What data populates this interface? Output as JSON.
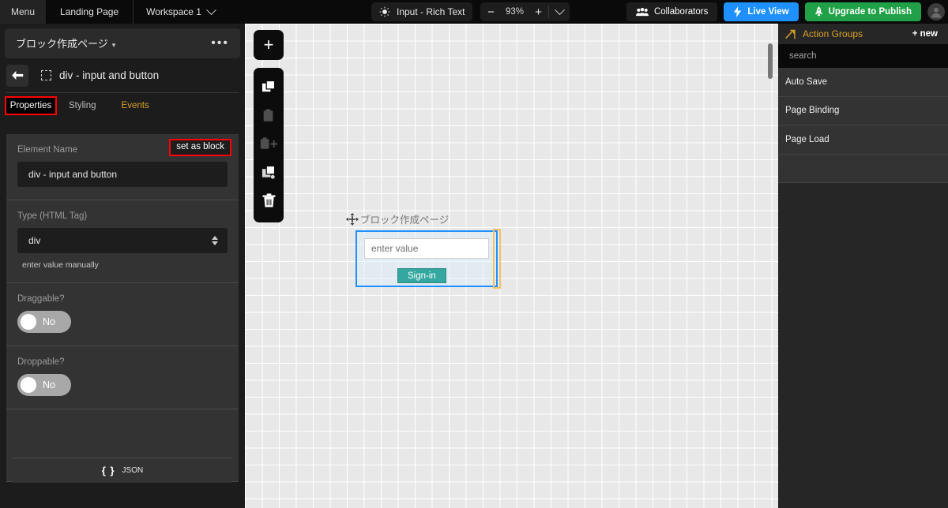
{
  "topbar": {
    "menu": "Menu",
    "page": "Landing Page",
    "workspace": "Workspace 1",
    "mode_pill": "Input - Rich Text",
    "zoom_minus": "−",
    "zoom_value": "93%",
    "zoom_plus": "+",
    "collaborators": "Collaborators",
    "live_view": "Live View",
    "upgrade": "Upgrade to Publish",
    "accent_blue": "#1e90ff",
    "accent_green": "#21a147"
  },
  "left_panel": {
    "page_title": "ブロック作成ページ",
    "page_title_caret": "▾",
    "overflow_dots": "•••",
    "breadcrumb_label": "div - input and button",
    "tabs": [
      {
        "label": "Properties",
        "state": "active-highlighted"
      },
      {
        "label": "Styling",
        "state": "normal"
      },
      {
        "label": "Events",
        "state": "accent"
      }
    ],
    "highlight_color": "#ff0000",
    "element_name": {
      "label": "Element Name",
      "value": "div - input and button",
      "set_as_block": "set as block"
    },
    "type_tag": {
      "label": "Type (HTML Tag)",
      "value": "div",
      "hint": "enter value manually"
    },
    "draggable": {
      "label": "Draggable?",
      "value": "No"
    },
    "droppable": {
      "label": "Droppable?",
      "value": "No"
    },
    "json_bar": {
      "braces": "{ }",
      "label": "JSON"
    }
  },
  "canvas": {
    "zoom_tools": {
      "add": "+",
      "icons": [
        "copy-icon",
        "paste-icon",
        "paste-add-icon",
        "duplicate-icon",
        "trash-icon"
      ]
    },
    "element_label": "ブロック作成ページ",
    "input_placeholder": "enter value",
    "button_label": "Sign-in",
    "selection_color": "#1e90ff",
    "sibling_outline_color": "#f5c267",
    "button_color": "#34a8a0"
  },
  "right_panel": {
    "title": "Action Groups",
    "new_label": "+ new",
    "search_placeholder": "search",
    "items": [
      "Auto Save",
      "Page Binding",
      "Page Load"
    ],
    "accent": "#d9a227"
  }
}
